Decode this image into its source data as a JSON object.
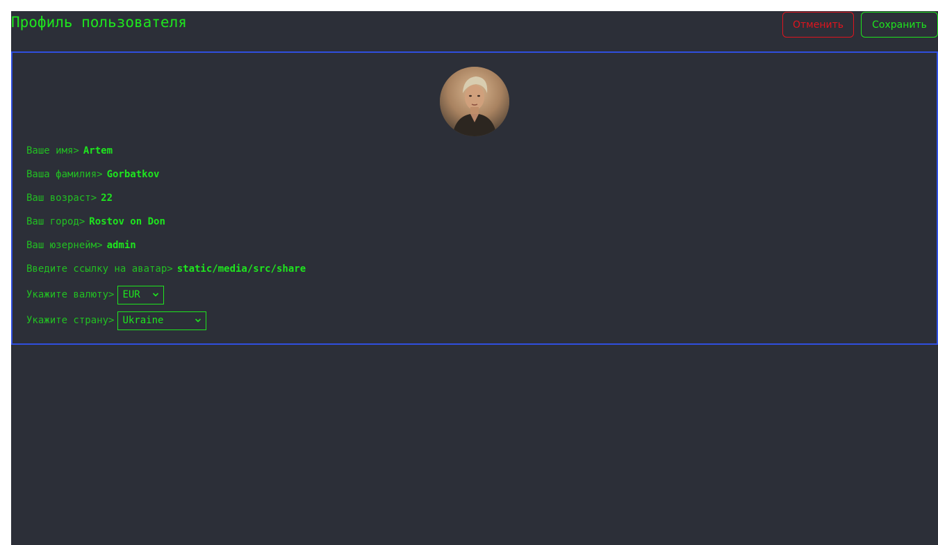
{
  "header": {
    "title": "Профиль пользователя",
    "cancel_label": "Отменить",
    "save_label": "Сохранить"
  },
  "colors": {
    "background": "#2c2f38",
    "accent_green": "#1ee61e",
    "cancel_red": "#e0141e",
    "card_border_blue": "#2f4fe0"
  },
  "profile": {
    "avatar_icon": "user-avatar-photo",
    "fields": {
      "first_name": {
        "label": "Ваше имя>",
        "value": "Artem"
      },
      "last_name": {
        "label": "Ваша фамилия>",
        "value": "Gorbatkov"
      },
      "age": {
        "label": "Ваш возраст>",
        "value": "22"
      },
      "city": {
        "label": "Ваш город>",
        "value": "Rostov on Don"
      },
      "username": {
        "label": "Ваш юзернейм>",
        "value": "admin"
      },
      "avatar_url": {
        "label": "Введите ссылку на аватар>",
        "value": "static/media/src/share"
      }
    },
    "currency": {
      "label": "Укажите валюту>",
      "selected": "EUR"
    },
    "country": {
      "label": "Укажите страну>",
      "selected": "Ukraine"
    }
  }
}
